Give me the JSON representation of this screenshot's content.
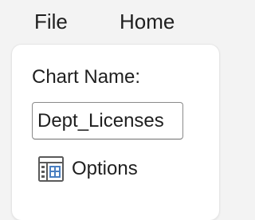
{
  "menubar": {
    "items": [
      {
        "label": "File"
      },
      {
        "label": "Home"
      }
    ]
  },
  "panel": {
    "chart_name_label": "Chart Name:",
    "chart_name_value": "Dept_Licenses",
    "options": {
      "label": "Options",
      "icon": "options-table-icon"
    }
  },
  "colors": {
    "background": "#f3f3f3",
    "panel": "#ffffff",
    "text": "#1f1f1f",
    "input_border": "#8a8a8a",
    "icon_accent": "#4a7fc1"
  }
}
